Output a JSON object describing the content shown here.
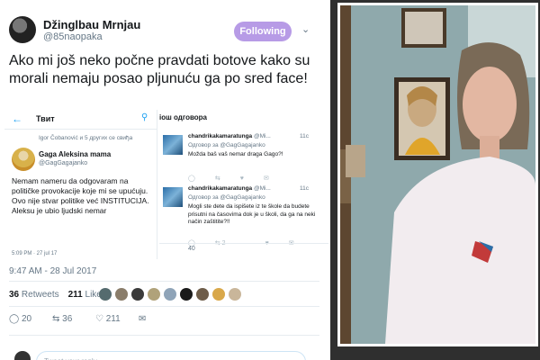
{
  "tweet": {
    "author_name": "Džinglbau Mrnjau",
    "author_handle": "@85naopaka",
    "follow_label": "Following",
    "caret_icon": "chevron-down-icon",
    "text": "Ako mi još neko počne pravdati botove kako su morali nemaju posao pljunuću ga po sred face!",
    "timestamp": "9:47 AM - 28 Jul 2017",
    "retweets_count": "36",
    "retweets_label": "Retweets",
    "likes_count": "211",
    "likes_label": "Likes",
    "actions": {
      "reply_count": "20",
      "retweet_count": "36",
      "like_count": "211"
    },
    "reply_placeholder": "Tweet your reply"
  },
  "embedded": {
    "title": "Твит",
    "retweet_note": "Igor Čobanović и 5 других се свиђа",
    "author_name": "Gaga Aleksina mama",
    "author_handle": "@GagGagajanko",
    "text": "Nemam nameru da odgovaram na političke provokacije koje mi se upućuju.\nOvo nije stvar politike već INSTITUCIJA.\nAleksu je ubio ljudski nemar",
    "time": "5:09 PM · 27 jul 17",
    "replies_header": "іош одговора",
    "replies": [
      {
        "name": "chandrikakamaratunga",
        "handle_short": "@Mi...",
        "time": "11с",
        "reply_to": "Одговор за @GagGagajanko",
        "text": "Možda baš vaš nemar draga Gago?!",
        "retweets": "",
        "likes": ""
      },
      {
        "name": "chandrikakamaratunga",
        "handle_short": "@Mi...",
        "time": "11с",
        "reply_to": "Одговор за @GagGagajanko",
        "text": "Mogli ste dete da ispišete iz te škole da budete prisutni na časovima dok je u školi, da ga na neki način zaštitite?!!",
        "retweets": "2",
        "likes": ""
      }
    ],
    "partial_reply_stub": "40"
  },
  "colors": {
    "follow_button": "#b79be6",
    "twitter_blue": "#1da1f2",
    "muted_text": "#657786"
  }
}
